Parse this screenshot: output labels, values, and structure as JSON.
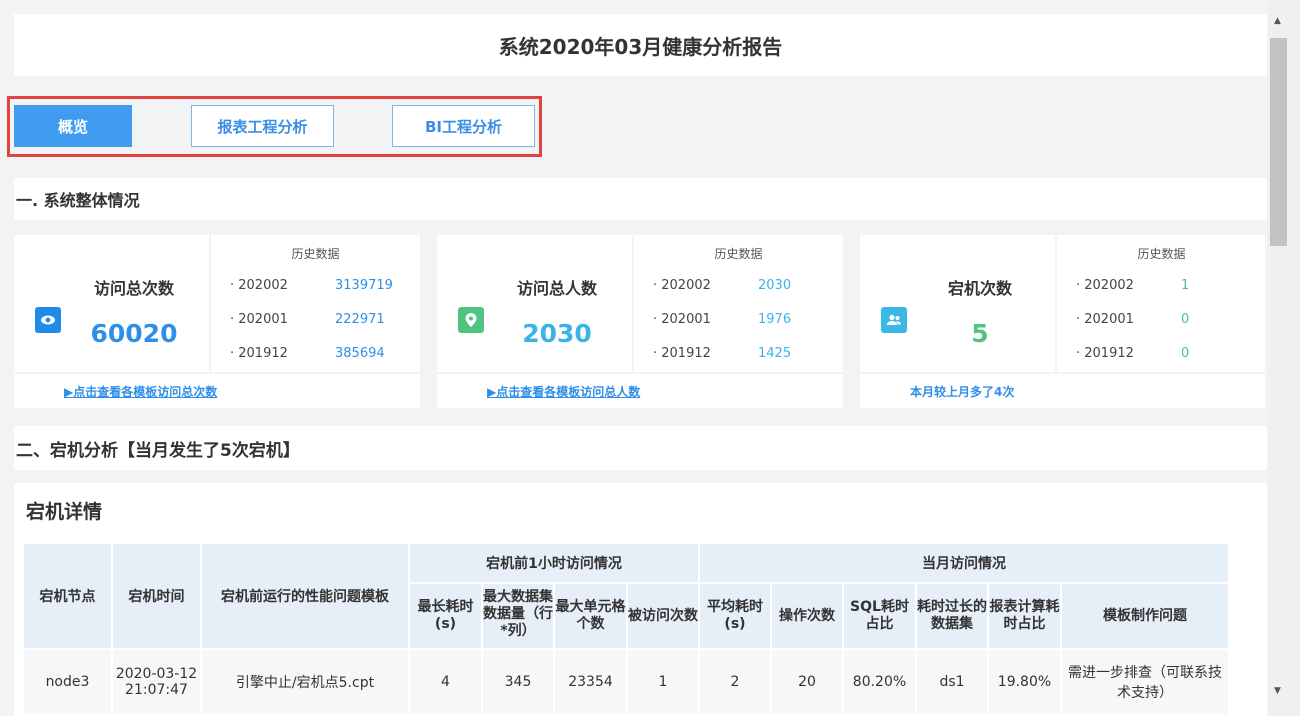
{
  "report_title": "系统2020年03月健康分析报告",
  "tabs": [
    {
      "label": "概览",
      "active": true
    },
    {
      "label": "报表工程分析",
      "active": false
    },
    {
      "label": "BI工程分析",
      "active": false
    }
  ],
  "section1_title": "一. 系统整体情况",
  "section2_title": "二、宕机分析【当月发生了5次宕机】",
  "history_label": "历史数据",
  "cards": [
    {
      "icon": "eye-icon",
      "label": "访问总次数",
      "value": "60020",
      "history": [
        {
          "period": "· 202002",
          "value": "3139719"
        },
        {
          "period": "· 202001",
          "value": "222971"
        },
        {
          "period": "· 201912",
          "value": "385694"
        }
      ],
      "footer": "▶点击查看各模板访问总次数"
    },
    {
      "icon": "location-pin-icon",
      "label": "访问总人数",
      "value": "2030",
      "history": [
        {
          "period": "· 202002",
          "value": "2030"
        },
        {
          "period": "· 202001",
          "value": "1976"
        },
        {
          "period": "· 201912",
          "value": "1425"
        }
      ],
      "footer": "▶点击查看各模板访问总人数"
    },
    {
      "icon": "users-icon",
      "label": "宕机次数",
      "value": "5",
      "history": [
        {
          "period": "· 202002",
          "value": "1"
        },
        {
          "period": "· 202001",
          "value": "0"
        },
        {
          "period": "· 201912",
          "value": "0"
        }
      ],
      "footer": "本月较上月多了4次"
    }
  ],
  "colors": {
    "accent_blue": "#409cf0",
    "highlight_red": "#e3433f",
    "value_blue": "#2f8fe8",
    "value_cyan": "#3cb3e8",
    "value_green": "#52c47f"
  },
  "crash_detail": {
    "title": "宕机详情",
    "headers": {
      "node": "宕机节点",
      "time": "宕机时间",
      "template": "宕机前运行的性能问题模板",
      "group_before": "宕机前1小时访问情况",
      "group_month": "当月访问情况",
      "max_time": "最长耗时(s)",
      "max_dataset": "最大数据集数据量（行*列）",
      "max_cells": "最大单元格个数",
      "visits": "被访问次数",
      "avg_time": "平均耗时(s)",
      "ops": "操作次数",
      "sql_ratio": "SQL耗时占比",
      "slow_dataset": "耗时过长的数据集",
      "calc_ratio": "报表计算耗时占比",
      "issue": "模板制作问题"
    },
    "rows": [
      {
        "node": "node3",
        "time": "2020-03-12 21:07:47",
        "template": "引擎中止/宕机点5.cpt",
        "max_time": "4",
        "max_dataset": "345",
        "max_cells": "23354",
        "visits": "1",
        "avg_time": "2",
        "ops": "20",
        "sql_ratio": "80.20%",
        "slow_dataset": "ds1",
        "calc_ratio": "19.80%",
        "issue": "需进一步排查（可联系技术支持）"
      }
    ]
  }
}
